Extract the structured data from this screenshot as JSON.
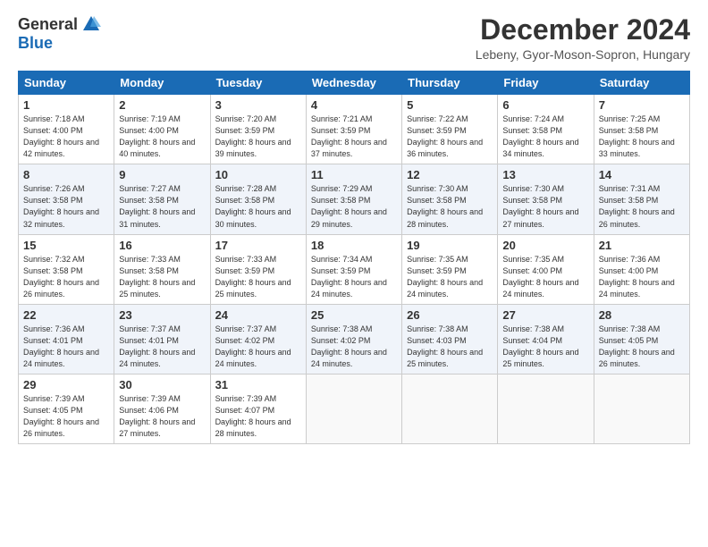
{
  "header": {
    "logo_general": "General",
    "logo_blue": "Blue",
    "title": "December 2024",
    "location": "Lebeny, Gyor-Moson-Sopron, Hungary"
  },
  "days_of_week": [
    "Sunday",
    "Monday",
    "Tuesday",
    "Wednesday",
    "Thursday",
    "Friday",
    "Saturday"
  ],
  "weeks": [
    [
      {
        "day": "1",
        "sunrise": "7:18 AM",
        "sunset": "4:00 PM",
        "daylight": "8 hours and 42 minutes."
      },
      {
        "day": "2",
        "sunrise": "7:19 AM",
        "sunset": "4:00 PM",
        "daylight": "8 hours and 40 minutes."
      },
      {
        "day": "3",
        "sunrise": "7:20 AM",
        "sunset": "3:59 PM",
        "daylight": "8 hours and 39 minutes."
      },
      {
        "day": "4",
        "sunrise": "7:21 AM",
        "sunset": "3:59 PM",
        "daylight": "8 hours and 37 minutes."
      },
      {
        "day": "5",
        "sunrise": "7:22 AM",
        "sunset": "3:59 PM",
        "daylight": "8 hours and 36 minutes."
      },
      {
        "day": "6",
        "sunrise": "7:24 AM",
        "sunset": "3:58 PM",
        "daylight": "8 hours and 34 minutes."
      },
      {
        "day": "7",
        "sunrise": "7:25 AM",
        "sunset": "3:58 PM",
        "daylight": "8 hours and 33 minutes."
      }
    ],
    [
      {
        "day": "8",
        "sunrise": "7:26 AM",
        "sunset": "3:58 PM",
        "daylight": "8 hours and 32 minutes."
      },
      {
        "day": "9",
        "sunrise": "7:27 AM",
        "sunset": "3:58 PM",
        "daylight": "8 hours and 31 minutes."
      },
      {
        "day": "10",
        "sunrise": "7:28 AM",
        "sunset": "3:58 PM",
        "daylight": "8 hours and 30 minutes."
      },
      {
        "day": "11",
        "sunrise": "7:29 AM",
        "sunset": "3:58 PM",
        "daylight": "8 hours and 29 minutes."
      },
      {
        "day": "12",
        "sunrise": "7:30 AM",
        "sunset": "3:58 PM",
        "daylight": "8 hours and 28 minutes."
      },
      {
        "day": "13",
        "sunrise": "7:30 AM",
        "sunset": "3:58 PM",
        "daylight": "8 hours and 27 minutes."
      },
      {
        "day": "14",
        "sunrise": "7:31 AM",
        "sunset": "3:58 PM",
        "daylight": "8 hours and 26 minutes."
      }
    ],
    [
      {
        "day": "15",
        "sunrise": "7:32 AM",
        "sunset": "3:58 PM",
        "daylight": "8 hours and 26 minutes."
      },
      {
        "day": "16",
        "sunrise": "7:33 AM",
        "sunset": "3:58 PM",
        "daylight": "8 hours and 25 minutes."
      },
      {
        "day": "17",
        "sunrise": "7:33 AM",
        "sunset": "3:59 PM",
        "daylight": "8 hours and 25 minutes."
      },
      {
        "day": "18",
        "sunrise": "7:34 AM",
        "sunset": "3:59 PM",
        "daylight": "8 hours and 24 minutes."
      },
      {
        "day": "19",
        "sunrise": "7:35 AM",
        "sunset": "3:59 PM",
        "daylight": "8 hours and 24 minutes."
      },
      {
        "day": "20",
        "sunrise": "7:35 AM",
        "sunset": "4:00 PM",
        "daylight": "8 hours and 24 minutes."
      },
      {
        "day": "21",
        "sunrise": "7:36 AM",
        "sunset": "4:00 PM",
        "daylight": "8 hours and 24 minutes."
      }
    ],
    [
      {
        "day": "22",
        "sunrise": "7:36 AM",
        "sunset": "4:01 PM",
        "daylight": "8 hours and 24 minutes."
      },
      {
        "day": "23",
        "sunrise": "7:37 AM",
        "sunset": "4:01 PM",
        "daylight": "8 hours and 24 minutes."
      },
      {
        "day": "24",
        "sunrise": "7:37 AM",
        "sunset": "4:02 PM",
        "daylight": "8 hours and 24 minutes."
      },
      {
        "day": "25",
        "sunrise": "7:38 AM",
        "sunset": "4:02 PM",
        "daylight": "8 hours and 24 minutes."
      },
      {
        "day": "26",
        "sunrise": "7:38 AM",
        "sunset": "4:03 PM",
        "daylight": "8 hours and 25 minutes."
      },
      {
        "day": "27",
        "sunrise": "7:38 AM",
        "sunset": "4:04 PM",
        "daylight": "8 hours and 25 minutes."
      },
      {
        "day": "28",
        "sunrise": "7:38 AM",
        "sunset": "4:05 PM",
        "daylight": "8 hours and 26 minutes."
      }
    ],
    [
      {
        "day": "29",
        "sunrise": "7:39 AM",
        "sunset": "4:05 PM",
        "daylight": "8 hours and 26 minutes."
      },
      {
        "day": "30",
        "sunrise": "7:39 AM",
        "sunset": "4:06 PM",
        "daylight": "8 hours and 27 minutes."
      },
      {
        "day": "31",
        "sunrise": "7:39 AM",
        "sunset": "4:07 PM",
        "daylight": "8 hours and 28 minutes."
      },
      null,
      null,
      null,
      null
    ]
  ]
}
